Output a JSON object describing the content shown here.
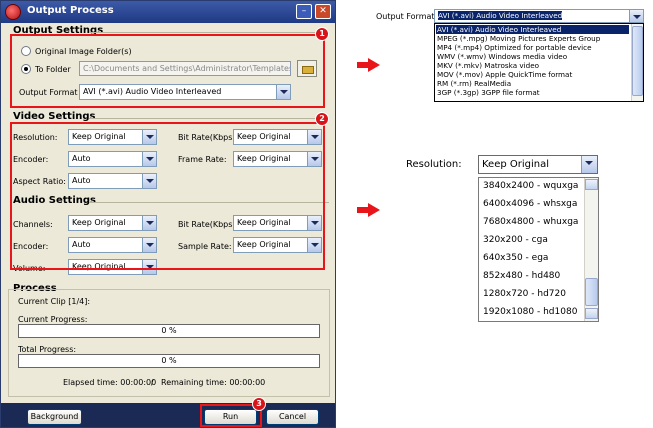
{
  "window": {
    "title": "Output Process"
  },
  "output_settings": {
    "title": "Output Settings",
    "original_folder_label": "Original Image Folder(s)",
    "to_folder_label": "To Folder",
    "to_folder_value": "C:\\Documents and Settings\\Administrator\\Templates",
    "output_format_label": "Output Format :",
    "output_format_value": "AVI  (*.avi) Audio Video Interleaved"
  },
  "video_settings": {
    "title": "Video Settings",
    "resolution_label": "Resolution:",
    "resolution_value": "Keep Original",
    "encoder_label": "Encoder:",
    "encoder_value": "Auto",
    "aspect_label": "Aspect Ratio:",
    "aspect_value": "Auto",
    "bitrate_label": "Bit Rate(Kbps):",
    "bitrate_value": "Keep Original",
    "framerate_label": "Frame Rate:",
    "framerate_value": "Keep Original"
  },
  "audio_settings": {
    "title": "Audio Settings",
    "channels_label": "Channels:",
    "channels_value": "Keep Original",
    "encoder_label": "Encoder:",
    "encoder_value": "Auto",
    "volume_label": "Volume:",
    "volume_value": "Keep Original",
    "bitrate_label": "Bit Rate(Kbps):",
    "bitrate_value": "Keep Original",
    "samplerate_label": "Sample Rate:",
    "samplerate_value": "Keep Original"
  },
  "process": {
    "title": "Process",
    "current_clip": "Current Clip [1/4]:",
    "current_progress_label": "Current Progress:",
    "current_progress_value": "0 %",
    "total_progress_label": "Total Progress:",
    "total_progress_value": "0 %",
    "elapsed": "Elapsed time: 00:00:00",
    "separator": "/",
    "remaining": "Remaining time: 00:00:00"
  },
  "buttons": {
    "background": "Background",
    "run": "Run",
    "cancel": "Cancel"
  },
  "badges": {
    "one": "1",
    "two": "2",
    "three": "3"
  },
  "format_dropdown": {
    "label": "Output Format :",
    "selected": "AVI  (*.avi) Audio Video Interleaved",
    "options": [
      "AVI  (*.avi) Audio Video Interleaved",
      "MPEG  (*.mpg) Moving Pictures Experts Group",
      "MP4  (*.mp4) Optimized for portable device",
      "WMV  (*.wmv) Windows media video",
      "MKV  (*.mkv) Matroska video",
      "MOV  (*.mov) Apple QuickTime format",
      "RM  (*.rm) RealMedia",
      "3GP  (*.3gp) 3GPP file format"
    ]
  },
  "resolution_dropdown": {
    "label": "Resolution:",
    "selected": "Keep Original",
    "options": [
      "3840x2400 - wquxga",
      "6400x4096 - whsxga",
      "7680x4800 - whuxga",
      "320x200 - cga",
      "640x350 - ega",
      "852x480 - hd480",
      "1280x720 - hd720",
      "1920x1080 - hd1080"
    ]
  },
  "colors": {
    "highlight": "#e8151b",
    "selection": "#0a246a",
    "titlebar": "#1f3a84"
  },
  "icons": [
    "app-icon",
    "minimize-icon",
    "close-icon",
    "folder-icon",
    "chevron-down-icon",
    "arrow-right-icon"
  ]
}
